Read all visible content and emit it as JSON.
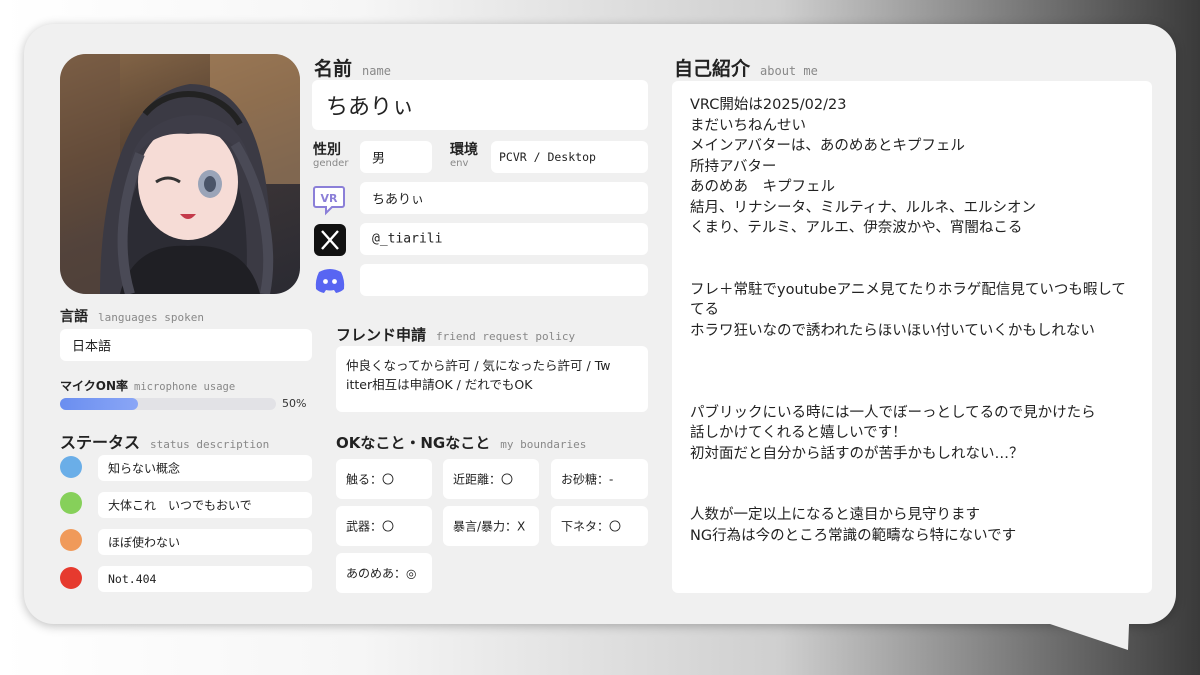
{
  "name": {
    "label": "名前",
    "sub": "name",
    "value": "ちありぃ"
  },
  "gender": {
    "label": "性別",
    "sub": "gender",
    "value": "男"
  },
  "env": {
    "label": "環境",
    "sub": "env",
    "value": "PCVR / Desktop"
  },
  "accounts": {
    "vrchat": "ちありぃ",
    "vr_badge": "VR",
    "twitter": "@_tiarili",
    "discord": ""
  },
  "languages": {
    "label": "言語",
    "sub": "languages spoken",
    "value": "日本語"
  },
  "mic": {
    "label": "マイクON率",
    "sub": "microphone usage",
    "percent_text": "50%",
    "percent": 0.5
  },
  "status": {
    "label": "ステータス",
    "sub": "status description",
    "items": [
      {
        "color": "#6aaee8",
        "text": "知らない概念"
      },
      {
        "color": "#86d05a",
        "text": "大体これ　いつでもおいで"
      },
      {
        "color": "#f09a5a",
        "text": "ほぼ使わない"
      },
      {
        "color": "#e63a2e",
        "text": "Not.404"
      }
    ]
  },
  "friend": {
    "label": "フレンド申請",
    "sub": "friend request policy",
    "line1": "仲良くなってから許可 / 気になったら許可 / Tw",
    "line2": "itter相互は申請OK / だれでもOK"
  },
  "boundaries": {
    "label": "OKなこと・NGなこと",
    "sub": "my boundaries",
    "items": [
      {
        "text": "触る：〇"
      },
      {
        "text": "近距離：〇"
      },
      {
        "text": "お砂糖：-"
      },
      {
        "text": "武器：〇"
      },
      {
        "text": "暴言/暴力：X"
      },
      {
        "text": "下ネタ：〇"
      },
      {
        "text": "あのめあ：◎"
      }
    ]
  },
  "about": {
    "label": "自己紹介",
    "sub": "about me",
    "text": "VRC開始は2025/02/23\nまだいちねんせい\nメインアバターは、あのめあとキプフェル\n所持アバター\nあのめあ　キプフェル\n結月、リナシータ、ミルティナ、ルルネ、エルシオン\nくまり、テルミ、アルエ、伊奈波かや、宵闇ねこる\n\n\nフレ＋常駐でyoutubeアニメ見てたりホラゲ配信見ていつも暇して\nてる\nホラワ狂いなので誘われたらほいほい付いていくかもしれない\n\n\n\nパブリックにいる時には一人でぼーっとしてるので見かけたら\n話しかけてくれると嬉しいです！\n初対面だと自分から話すのが苦手かもしれない…？\n\n\n人数が一定以上になると遠目から見守ります\nNG行為は今のところ常識の範疇なら特にないです"
  }
}
